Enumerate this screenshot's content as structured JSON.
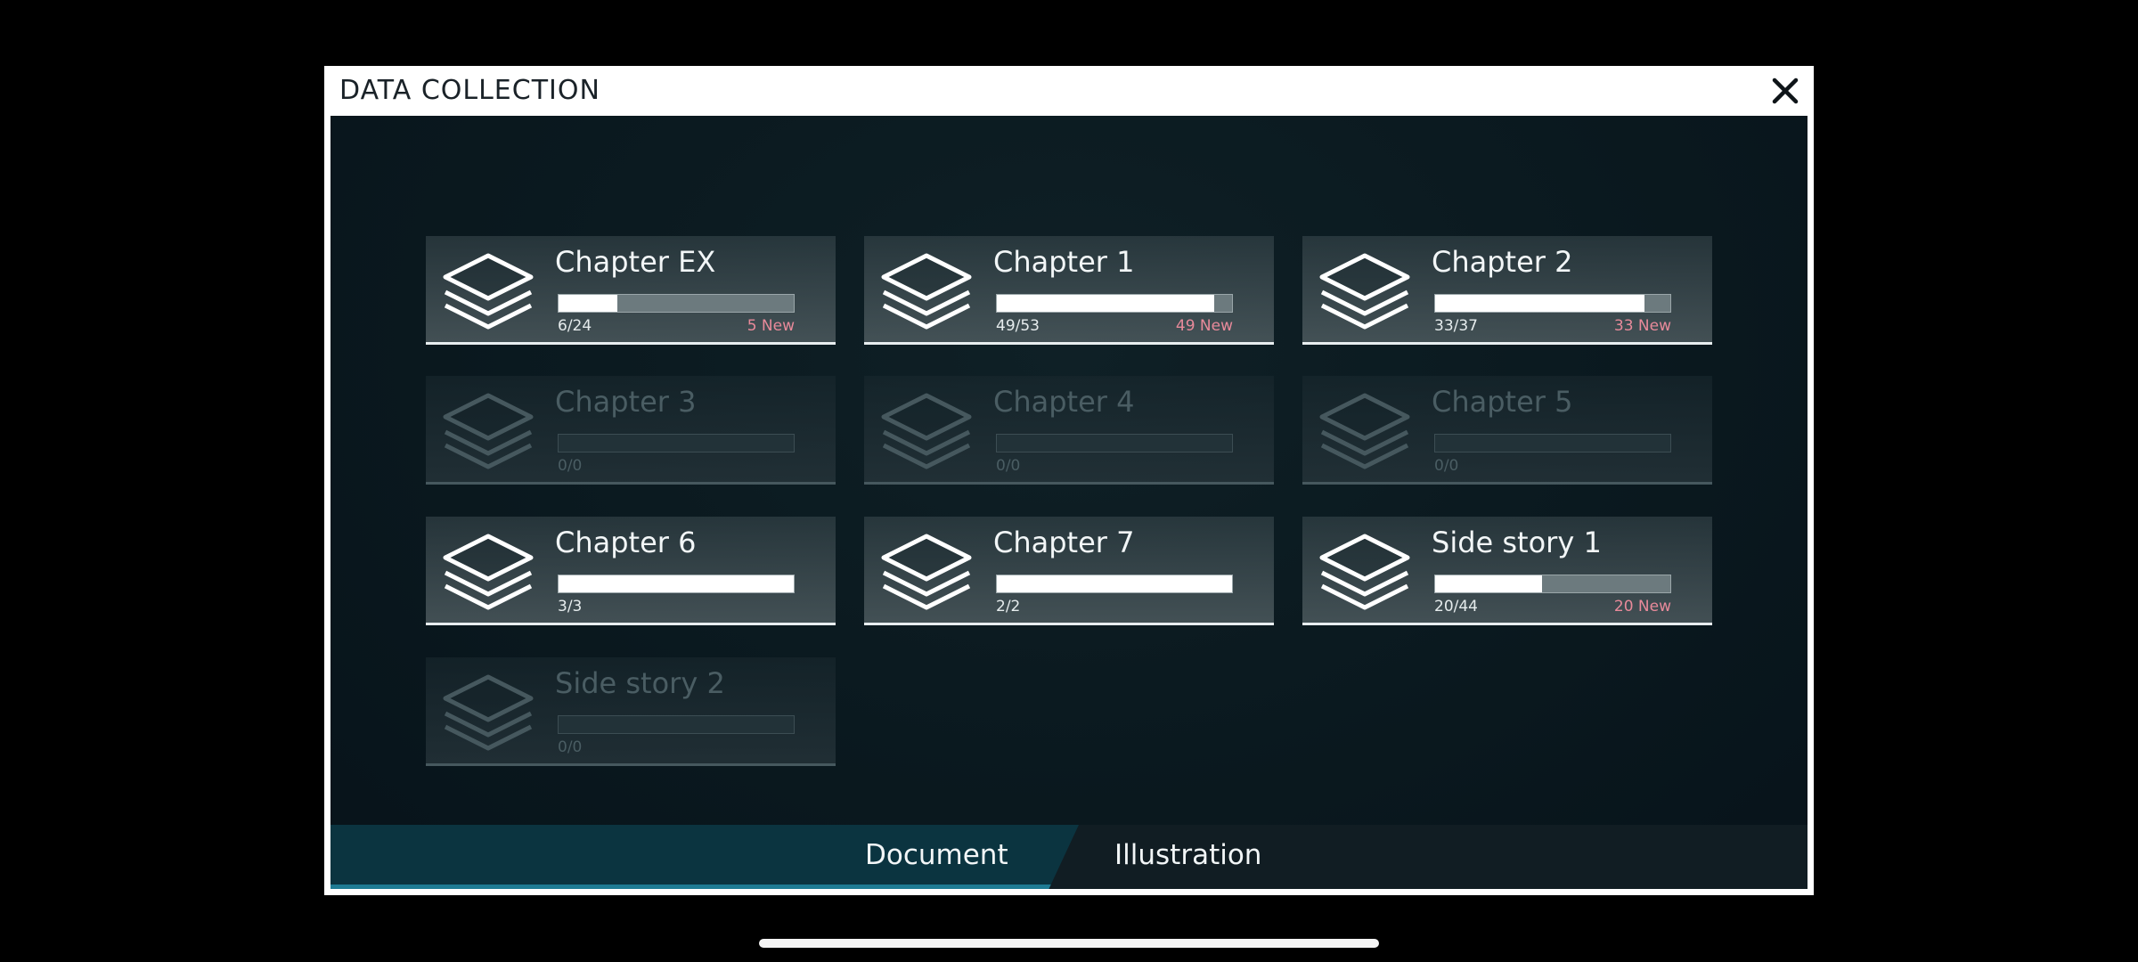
{
  "modal": {
    "title": "DATA COLLECTION",
    "close_icon": "close-icon"
  },
  "chapters": [
    {
      "name": "Chapter EX",
      "count": "6/24",
      "new": "5 New",
      "progress": 0.25,
      "locked": false
    },
    {
      "name": "Chapter 1",
      "count": "49/53",
      "new": "49 New",
      "progress": 0.9245,
      "locked": false
    },
    {
      "name": "Chapter 2",
      "count": "33/37",
      "new": "33 New",
      "progress": 0.8919,
      "locked": false
    },
    {
      "name": "Chapter 3",
      "count": "0/0",
      "new": "",
      "progress": 0,
      "locked": true
    },
    {
      "name": "Chapter 4",
      "count": "0/0",
      "new": "",
      "progress": 0,
      "locked": true
    },
    {
      "name": "Chapter 5",
      "count": "0/0",
      "new": "",
      "progress": 0,
      "locked": true
    },
    {
      "name": "Chapter 6",
      "count": "3/3",
      "new": "",
      "progress": 1.0,
      "locked": false
    },
    {
      "name": "Chapter 7",
      "count": "2/2",
      "new": "",
      "progress": 1.0,
      "locked": false
    },
    {
      "name": "Side story 1",
      "count": "20/44",
      "new": "20 New",
      "progress": 0.4545,
      "locked": false
    },
    {
      "name": "Side story 2",
      "count": "0/0",
      "new": "",
      "progress": 0,
      "locked": true
    }
  ],
  "tabs": {
    "document": "Document",
    "illustration": "Illustration",
    "active": "Document"
  },
  "colors": {
    "new_tag": "#e88a9a",
    "active_tab": "#0b3440",
    "tab_underline": "#1e7b93"
  }
}
